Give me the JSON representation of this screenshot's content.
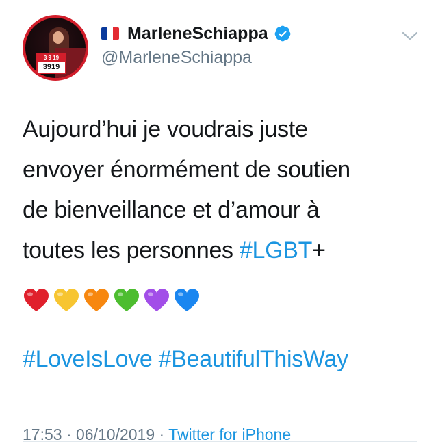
{
  "user": {
    "display_name": "MarleneSchiappa",
    "handle": "@MarleneSchiappa",
    "verified": true,
    "flag": "France",
    "avatar_badge_top": "3 9 19",
    "avatar_badge_number": "3919"
  },
  "tweet": {
    "lines": [
      {
        "text": "Aujourd’hui je voudrais juste"
      },
      {
        "text": "envoyer énormément de soutien"
      },
      {
        "text": "de bienveillance et d’amour à"
      },
      {
        "text": "toutes les personnes ",
        "hashtag": "#LGBT",
        "after": "+"
      }
    ],
    "hearts": [
      {
        "name": "red-heart-icon",
        "color": "#e0202c"
      },
      {
        "name": "yellow-heart-icon",
        "color": "#f7c531"
      },
      {
        "name": "orange-heart-icon",
        "color": "#f7870f"
      },
      {
        "name": "green-heart-icon",
        "color": "#4dbd2f"
      },
      {
        "name": "purple-heart-icon",
        "color": "#a24ee8"
      },
      {
        "name": "blue-heart-icon",
        "color": "#1a86f0"
      }
    ],
    "hashtags": [
      "#LoveIsLove",
      "#BeautifulThisWay"
    ]
  },
  "meta": {
    "time": "17:53",
    "separator": " · ",
    "date": "06/10/2019",
    "source": "Twitter for iPhone"
  },
  "colors": {
    "link": "#1b95e0",
    "secondary": "#657786",
    "text": "#14171a",
    "verified": "#1da1f2"
  },
  "icons": {
    "verified": "verified-badge-icon",
    "more": "chevron-down-icon"
  }
}
